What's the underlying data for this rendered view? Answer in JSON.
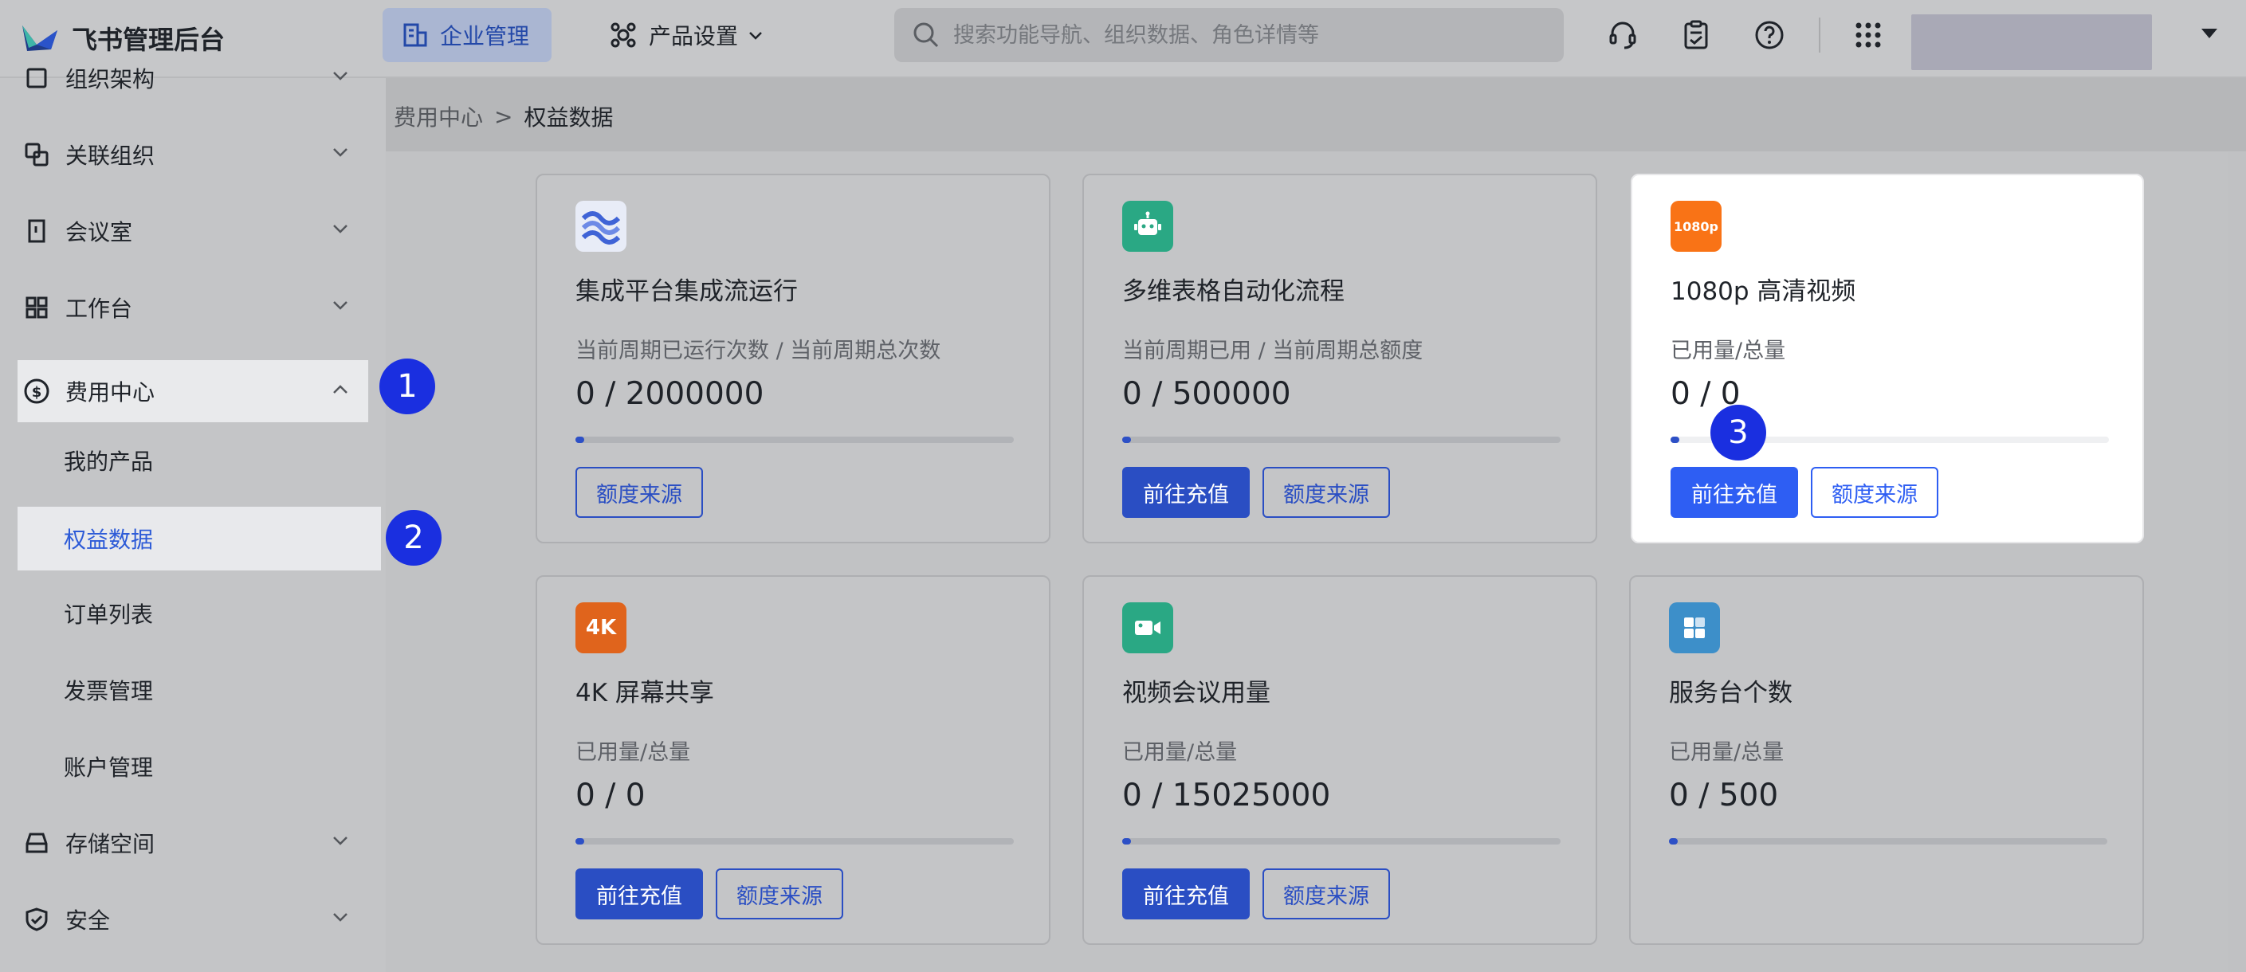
{
  "app": {
    "brand_name": "飞书管理后台"
  },
  "topnav": {
    "enterprise_label": "企业管理",
    "product_label": "产品设置",
    "search_placeholder": "搜索功能导航、组织数据、角色详情等"
  },
  "sidebar": {
    "items": [
      {
        "label": "组织架构",
        "icon": "org-icon"
      },
      {
        "label": "关联组织",
        "icon": "link-org-icon"
      },
      {
        "label": "会议室",
        "icon": "door-icon"
      },
      {
        "label": "工作台",
        "icon": "grid-icon"
      },
      {
        "label": "费用中心",
        "icon": "dollar-icon"
      },
      {
        "label": "存储空间",
        "icon": "storage-icon"
      },
      {
        "label": "安全",
        "icon": "shield-icon"
      }
    ],
    "sub_items": [
      "我的产品",
      "权益数据",
      "订单列表",
      "发票管理",
      "账户管理"
    ]
  },
  "breadcrumb": {
    "parent": "费用中心",
    "separator": ">",
    "current": "权益数据"
  },
  "cards": [
    {
      "title": "集成平台集成流运行",
      "subtitle": "当前周期已运行次数 / 当前周期总次数",
      "value": "0 / 2000000",
      "progress": 0,
      "icon": "integration-icon",
      "icon_color": "#e8ecf7",
      "recharge_label": "",
      "source_label": "额度来源"
    },
    {
      "title": "多维表格自动化流程",
      "subtitle": "当前周期已用 / 当前周期总额度",
      "value": "0 / 500000",
      "progress": 0,
      "icon": "robot-icon",
      "icon_color": "#2aa884",
      "recharge_label": "前往充值",
      "source_label": "额度来源"
    },
    {
      "title": "1080p 高清视频",
      "subtitle": "已用量/总量",
      "value": "0 / 0",
      "progress": 0,
      "icon": "hd-1080p-icon",
      "icon_color": "#f97316",
      "icon_text": "1080p",
      "recharge_label": "前往充值",
      "source_label": "额度来源"
    },
    {
      "title": "4K 屏幕共享",
      "subtitle": "已用量/总量",
      "value": "0 / 0",
      "progress": 0,
      "icon": "4k-icon",
      "icon_color": "#e0641c",
      "icon_text": "4K",
      "recharge_label": "前往充值",
      "source_label": "额度来源"
    },
    {
      "title": "视频会议用量",
      "subtitle": "已用量/总量",
      "value": "0 / 15025000",
      "progress": 0,
      "icon": "video-camera-icon",
      "icon_color": "#2aa884",
      "recharge_label": "前往充值",
      "source_label": "额度来源"
    },
    {
      "title": "服务台个数",
      "subtitle": "已用量/总量",
      "value": "0 / 500",
      "progress": 0,
      "icon": "service-desk-icon",
      "icon_color": "#3d8fc9",
      "recharge_label": "",
      "source_label": ""
    }
  ],
  "badges": [
    "1",
    "2",
    "3"
  ]
}
